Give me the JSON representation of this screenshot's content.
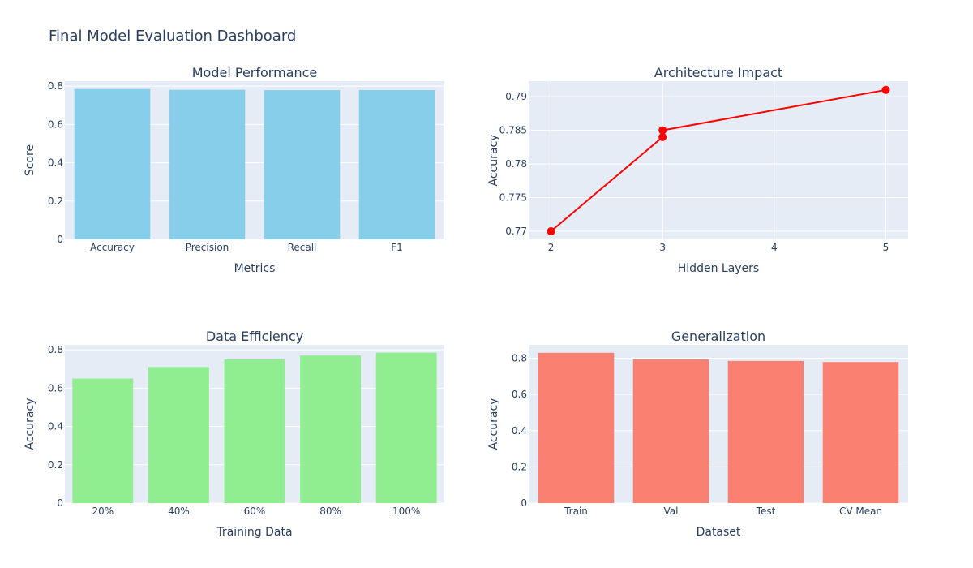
{
  "dashboard": {
    "title": "Final Model Evaluation Dashboard"
  },
  "colors": {
    "plot_bg": "#e5ecf6",
    "grid": "#ffffff",
    "text": "#2a3f5f"
  },
  "chart_data": [
    {
      "type": "bar",
      "title": "Model Performance",
      "xlabel": "Metrics",
      "ylabel": "Score",
      "categories": [
        "Accuracy",
        "Precision",
        "Recall",
        "F1"
      ],
      "values": [
        0.785,
        0.781,
        0.779,
        0.78
      ],
      "ylim": [
        0,
        0.826
      ],
      "yticks": [
        0,
        0.2,
        0.4,
        0.6,
        0.8
      ],
      "ytick_labels": [
        "0",
        "0.2",
        "0.4",
        "0.6",
        "0.8"
      ],
      "color": "#87ceeb",
      "grid": true
    },
    {
      "type": "line",
      "title": "Architecture Impact",
      "xlabel": "Hidden Layers",
      "ylabel": "Accuracy",
      "x": [
        2,
        3,
        3,
        5
      ],
      "y": [
        0.77,
        0.784,
        0.785,
        0.791
      ],
      "xlim": [
        1.8,
        5.2
      ],
      "ylim": [
        0.7688,
        0.7923
      ],
      "xticks": [
        2,
        3,
        4,
        5
      ],
      "xtick_labels": [
        "2",
        "3",
        "4",
        "5"
      ],
      "yticks": [
        0.77,
        0.775,
        0.78,
        0.785,
        0.79
      ],
      "ytick_labels": [
        "0.77",
        "0.775",
        "0.78",
        "0.785",
        "0.79"
      ],
      "color": "#ff0000",
      "markers": true,
      "grid": true
    },
    {
      "type": "bar",
      "title": "Data Efficiency",
      "xlabel": "Training Data",
      "ylabel": "Accuracy",
      "categories": [
        "20%",
        "40%",
        "60%",
        "80%",
        "100%"
      ],
      "values": [
        0.65,
        0.71,
        0.75,
        0.77,
        0.785
      ],
      "ylim": [
        0,
        0.826
      ],
      "yticks": [
        0,
        0.2,
        0.4,
        0.6,
        0.8
      ],
      "ytick_labels": [
        "0",
        "0.2",
        "0.4",
        "0.6",
        "0.8"
      ],
      "color": "#90ee90",
      "grid": true
    },
    {
      "type": "bar",
      "title": "Generalization",
      "xlabel": "Dataset",
      "ylabel": "Accuracy",
      "categories": [
        "Train",
        "Val",
        "Test",
        "CV Mean"
      ],
      "values": [
        0.83,
        0.793,
        0.785,
        0.779
      ],
      "ylim": [
        0,
        0.874
      ],
      "yticks": [
        0,
        0.2,
        0.4,
        0.6,
        0.8
      ],
      "ytick_labels": [
        "0",
        "0.2",
        "0.4",
        "0.6",
        "0.8"
      ],
      "color": "#fa8072",
      "grid": true
    }
  ]
}
